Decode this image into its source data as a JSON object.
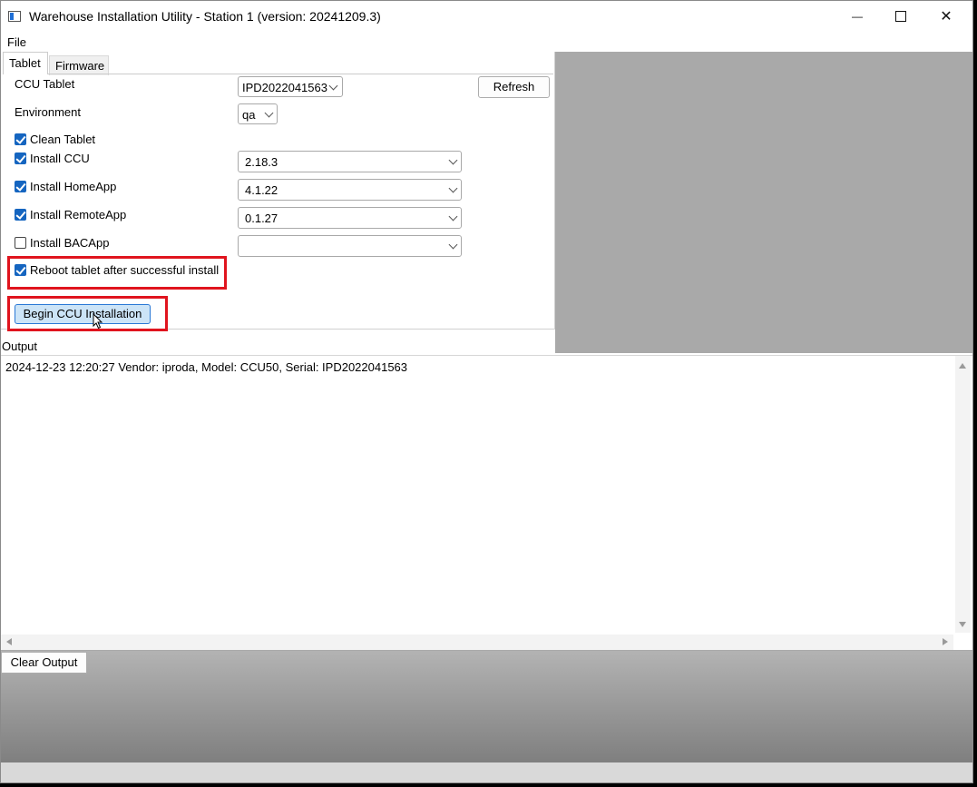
{
  "window": {
    "title": "Warehouse Installation Utility - Station 1 (version: 20241209.3)",
    "controls": {
      "minimize": "—",
      "close": "✕"
    }
  },
  "menu": {
    "file": "File"
  },
  "tabs": [
    {
      "label": "Tablet",
      "active": true
    },
    {
      "label": "Firmware",
      "active": false
    }
  ],
  "form": {
    "ccu_tablet": {
      "label": "CCU Tablet",
      "value": "IPD2022041563"
    },
    "refresh_button": "Refresh",
    "environment": {
      "label": "Environment",
      "value": "qa"
    },
    "clean_tablet": {
      "label": "Clean Tablet",
      "checked": true
    },
    "install_ccu": {
      "label": "Install CCU",
      "checked": true,
      "version": "2.18.3"
    },
    "install_homeapp": {
      "label": "Install HomeApp",
      "checked": true,
      "version": "4.1.22"
    },
    "install_remoteapp": {
      "label": "Install RemoteApp",
      "checked": true,
      "version": "0.1.27"
    },
    "install_bacapp": {
      "label": "Install BACApp",
      "checked": false,
      "version": ""
    },
    "reboot_tablet": {
      "label": "Reboot tablet after successful install",
      "checked": true
    },
    "begin_button": "Begin CCU Installation"
  },
  "output": {
    "label": "Output",
    "lines": [
      "2024-12-23 12:20:27 Vendor: iproda, Model: CCU50, Serial: IPD2022041563"
    ]
  },
  "clear_button": "Clear Output",
  "colors": {
    "highlight": "#e0141e",
    "checkbox": "#1565c0",
    "button_active": "#cce4f7"
  }
}
